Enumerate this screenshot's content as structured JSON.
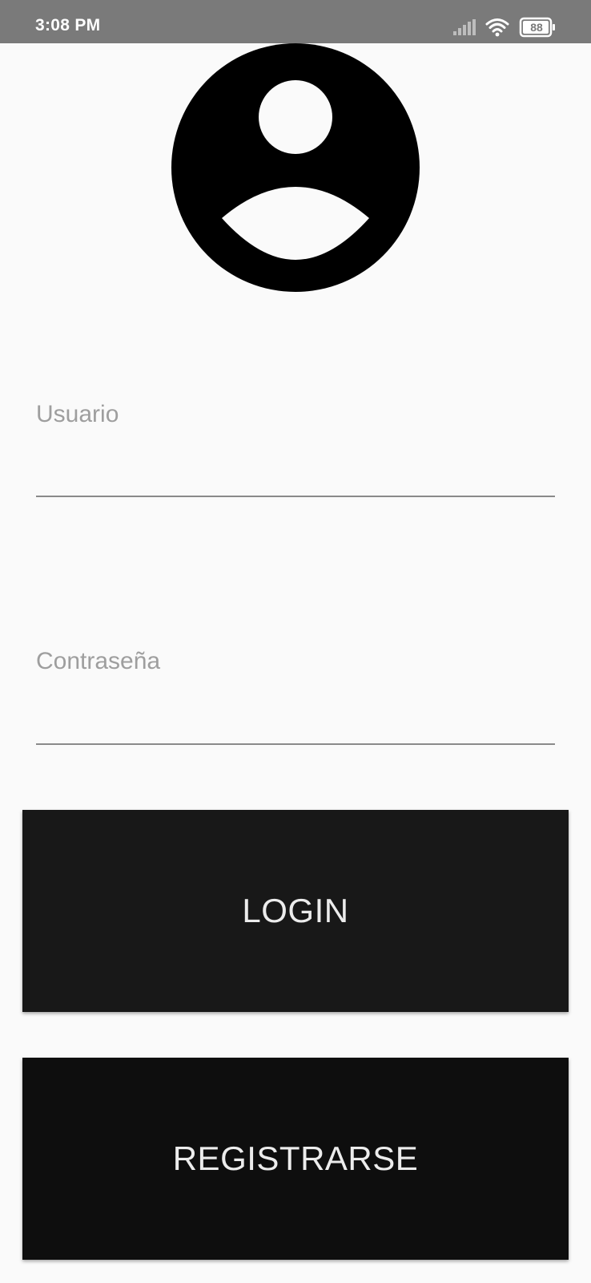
{
  "status_bar": {
    "time": "3:08 PM",
    "battery": "88",
    "icons": [
      "signal-icon",
      "wifi-icon",
      "battery-icon"
    ]
  },
  "avatar": {
    "icon": "account-circle-icon"
  },
  "form": {
    "username": {
      "label": "Usuario",
      "value": ""
    },
    "password": {
      "label": "Contraseña",
      "value": ""
    }
  },
  "buttons": {
    "login_label": "LOGIN",
    "register_label": "REGISTRARSE"
  },
  "colors": {
    "status_bar": "#7a7a7a",
    "background": "#fafafa",
    "button": "#181818",
    "button_text": "#ececec",
    "label": "#9e9e9e"
  }
}
